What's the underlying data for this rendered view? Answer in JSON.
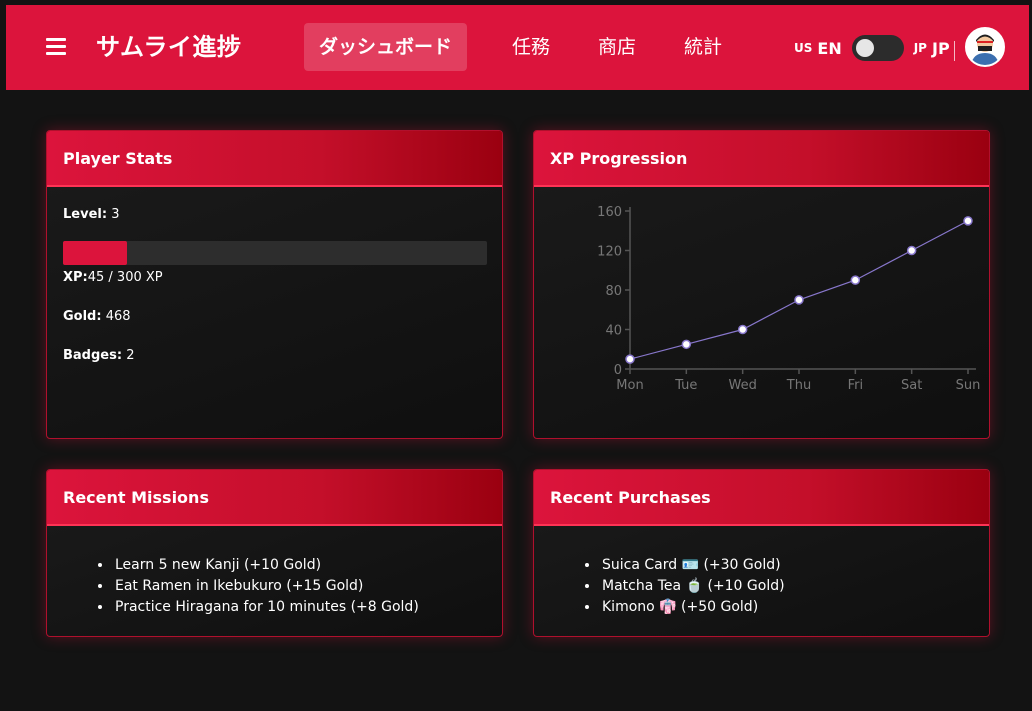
{
  "header": {
    "app_title": "サムライ進捗",
    "nav": [
      {
        "label": "ダッシュボード",
        "active": true
      },
      {
        "label": "任務",
        "active": false
      },
      {
        "label": "商店",
        "active": false
      },
      {
        "label": "統計",
        "active": false
      }
    ],
    "lang_en_flag": "US",
    "lang_en": "EN",
    "lang_jp_flag": "JP",
    "lang_jp": "JP",
    "accent_color": "#dc143c"
  },
  "player_stats": {
    "title": "Player Stats",
    "level_label": "Level:",
    "level_value": "3",
    "xp_label": "XP:",
    "xp_text": "45 / 300 XP",
    "xp_fraction": 0.15,
    "gold_label": "Gold:",
    "gold_value": "468",
    "badges_label": "Badges:",
    "badges_value": "2"
  },
  "xp_progression": {
    "title": "XP Progression"
  },
  "chart_data": {
    "type": "line",
    "categories": [
      "Mon",
      "Tue",
      "Wed",
      "Thu",
      "Fri",
      "Sat",
      "Sun"
    ],
    "values": [
      10,
      25,
      40,
      70,
      90,
      120,
      150
    ],
    "ylim": [
      0,
      160
    ],
    "yticks": [
      0,
      40,
      80,
      120,
      160
    ],
    "line_color": "#8877cc",
    "grid": false
  },
  "recent_missions": {
    "title": "Recent Missions",
    "items": [
      "Learn 5 new Kanji (+10 Gold)",
      "Eat Ramen in Ikebukuro (+15 Gold)",
      "Practice Hiragana for 10 minutes (+8 Gold)"
    ]
  },
  "recent_purchases": {
    "title": "Recent Purchases",
    "items": [
      "Suica Card 🪪 (+30 Gold)",
      "Matcha Tea 🍵 (+10 Gold)",
      "Kimono 👘 (+50 Gold)"
    ]
  }
}
